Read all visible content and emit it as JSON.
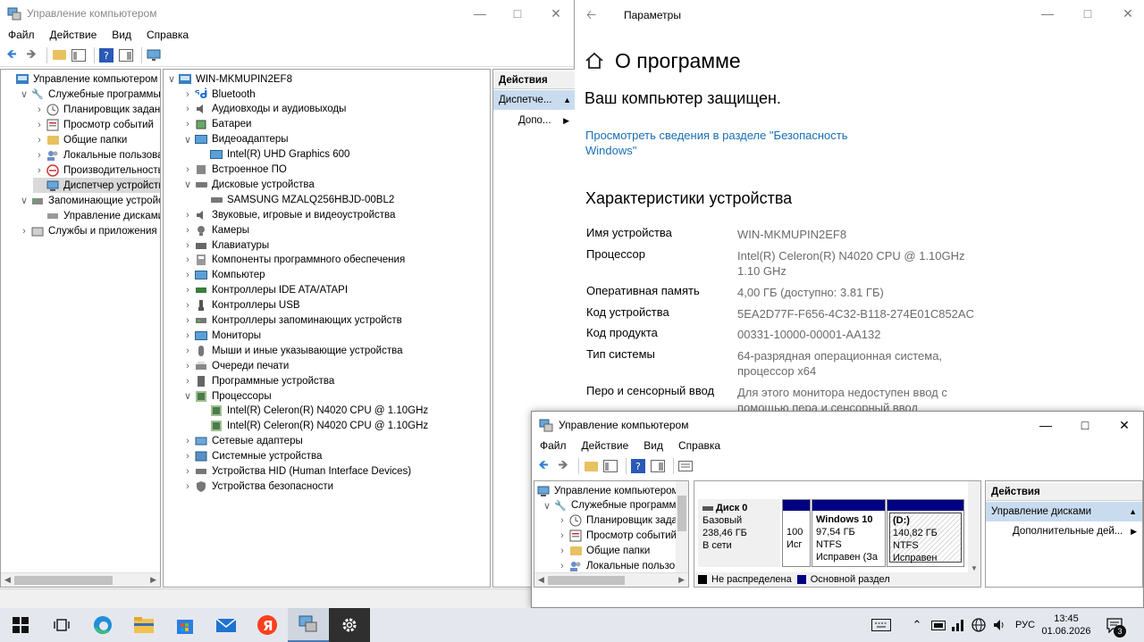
{
  "mmc_main": {
    "title": "Управление компьютером",
    "menu": [
      "Файл",
      "Действие",
      "Вид",
      "Справка"
    ],
    "tree": [
      {
        "label": "Управление компьютером (л",
        "level": 0,
        "chev": "",
        "icon": "computer"
      },
      {
        "label": "Служебные программы",
        "level": 1,
        "chev": "v",
        "icon": "tools"
      },
      {
        "label": "Планировщик заданий",
        "level": 2,
        "chev": ">",
        "icon": "clock"
      },
      {
        "label": "Просмотр событий",
        "level": 2,
        "chev": ">",
        "icon": "events"
      },
      {
        "label": "Общие папки",
        "level": 2,
        "chev": ">",
        "icon": "folder"
      },
      {
        "label": "Локальные пользовате",
        "level": 2,
        "chev": ">",
        "icon": "users"
      },
      {
        "label": "Производительность",
        "level": 2,
        "chev": ">",
        "icon": "perf"
      },
      {
        "label": "Диспетчер устройств",
        "level": 2,
        "chev": "",
        "icon": "devmgr",
        "selected": true
      },
      {
        "label": "Запоминающие устройст",
        "level": 1,
        "chev": "v",
        "icon": "storage"
      },
      {
        "label": "Управление дисками",
        "level": 2,
        "chev": "",
        "icon": "diskmgmt"
      },
      {
        "label": "Службы и приложения",
        "level": 1,
        "chev": ">",
        "icon": "services"
      }
    ],
    "device_root": "WIN-MKMUPIN2EF8",
    "devices": [
      {
        "label": "Bluetooth",
        "chev": ">",
        "icon": "bluetooth"
      },
      {
        "label": "Аудиовходы и аудиовыходы",
        "chev": ">",
        "icon": "speaker"
      },
      {
        "label": "Батареи",
        "chev": ">",
        "icon": "battery"
      },
      {
        "label": "Видеоадаптеры",
        "chev": "v",
        "icon": "monitor"
      },
      {
        "label": "Intel(R) UHD Graphics 600",
        "chev": "",
        "icon": "monitor",
        "child": true
      },
      {
        "label": "Встроенное ПО",
        "chev": ">",
        "icon": "firmware"
      },
      {
        "label": "Дисковые устройства",
        "chev": "v",
        "icon": "disk"
      },
      {
        "label": "SAMSUNG MZALQ256HBJD-00BL2",
        "chev": "",
        "icon": "disk",
        "child": true
      },
      {
        "label": "Звуковые, игровые и видеоустройства",
        "chev": ">",
        "icon": "speaker"
      },
      {
        "label": "Камеры",
        "chev": ">",
        "icon": "camera"
      },
      {
        "label": "Клавиатуры",
        "chev": ">",
        "icon": "keyboard"
      },
      {
        "label": "Компоненты программного обеспечения",
        "chev": ">",
        "icon": "software"
      },
      {
        "label": "Компьютер",
        "chev": ">",
        "icon": "monitor"
      },
      {
        "label": "Контроллеры IDE ATA/ATAPI",
        "chev": ">",
        "icon": "ide"
      },
      {
        "label": "Контроллеры USB",
        "chev": ">",
        "icon": "usb"
      },
      {
        "label": "Контроллеры запоминающих устройств",
        "chev": ">",
        "icon": "storagectl"
      },
      {
        "label": "Мониторы",
        "chev": ">",
        "icon": "monitor"
      },
      {
        "label": "Мыши и иные указывающие устройства",
        "chev": ">",
        "icon": "mouse"
      },
      {
        "label": "Очереди печати",
        "chev": ">",
        "icon": "printer"
      },
      {
        "label": "Программные устройства",
        "chev": ">",
        "icon": "softdev"
      },
      {
        "label": "Процессоры",
        "chev": "v",
        "icon": "cpu"
      },
      {
        "label": "Intel(R) Celeron(R) N4020 CPU @ 1.10GHz",
        "chev": "",
        "icon": "cpu",
        "child": true
      },
      {
        "label": "Intel(R) Celeron(R) N4020 CPU @ 1.10GHz",
        "chev": "",
        "icon": "cpu",
        "child": true
      },
      {
        "label": "Сетевые адаптеры",
        "chev": ">",
        "icon": "network"
      },
      {
        "label": "Системные устройства",
        "chev": ">",
        "icon": "system"
      },
      {
        "label": "Устройства HID (Human Interface Devices)",
        "chev": ">",
        "icon": "hid"
      },
      {
        "label": "Устройства безопасности",
        "chev": ">",
        "icon": "security"
      }
    ],
    "actions": {
      "header": "Действия",
      "selected": "Диспетче...",
      "more": "Допо..."
    }
  },
  "settings": {
    "title": "Параметры",
    "page_title": "О программе",
    "protected": "Ваш компьютер защищен.",
    "link_line1": "Просмотреть сведения в разделе \"Безопасность",
    "link_line2": "Windows\"",
    "specs_title": "Характеристики устройства",
    "specs": [
      {
        "label": "Имя устройства",
        "value": "WIN-MKMUPIN2EF8",
        "value2": ""
      },
      {
        "label": "Процессор",
        "value": "Intel(R) Celeron(R) N4020 CPU @ 1.10GHz",
        "value2": "1.10 GHz"
      },
      {
        "label": "Оперативная память",
        "value": "4,00 ГБ (доступно: 3.81 ГБ)",
        "value2": ""
      },
      {
        "label": "Код устройства",
        "value": "5EA2D77F-F656-4C32-B118-274E01C852AC",
        "value2": ""
      },
      {
        "label": "Код продукта",
        "value": "00331-10000-00001-AA132",
        "value2": ""
      },
      {
        "label": "Тип системы",
        "value": "64-разрядная операционная система,",
        "value2": "процессор x64"
      },
      {
        "label": "Перо и сенсорный ввод",
        "value": "Для этого монитора недоступен ввод с",
        "value2": "помощью пера и сенсорный ввод"
      }
    ]
  },
  "mmc_disk": {
    "title": "Управление компьютером",
    "menu": [
      "Файл",
      "Действие",
      "Вид",
      "Справка"
    ],
    "tree": [
      {
        "label": "Управление компьютером",
        "chev": ""
      },
      {
        "label": "Служебные программ",
        "chev": "v"
      },
      {
        "label": "Планировщик зада",
        "chev": ">"
      },
      {
        "label": "Просмотр событий",
        "chev": ">"
      },
      {
        "label": "Общие папки",
        "chev": ">"
      },
      {
        "label": "Локальные пользов",
        "chev": ">"
      }
    ],
    "disk": {
      "name": "Диск 0",
      "type": "Базовый",
      "size": "238,46 ГБ",
      "status": "В сети",
      "partitions": [
        {
          "line1": "",
          "line2": "100",
          "line3": "Исг"
        },
        {
          "line1": "Windows 10",
          "line2": "97,54 ГБ NTFS",
          "line3": "Исправен (За"
        },
        {
          "line1": "(D:)",
          "line2": "140,82 ГБ NTFS",
          "line3": "Исправен (Баз"
        }
      ]
    },
    "legend": [
      {
        "label": "Не распределена",
        "color": "#000000"
      },
      {
        "label": "Основной раздел",
        "color": "#000080"
      }
    ],
    "actions": {
      "header": "Действия",
      "selected": "Управление дисками",
      "more": "Дополнительные дей..."
    }
  },
  "taskbar": {
    "lang": "РУС",
    "time": "13:45",
    "date": "01.06.2026",
    "notif_count": "3"
  }
}
